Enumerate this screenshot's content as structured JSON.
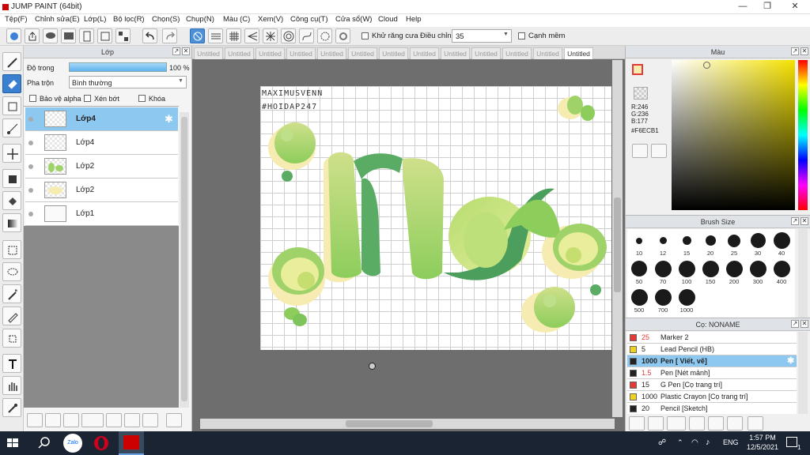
{
  "window": {
    "title": "JUMP PAINT (64bit)"
  },
  "menu": [
    "Tệp(F)",
    "Chỉnh sửa(E)",
    "Lớp(L)",
    "Bộ lọc(R)",
    "Chọn(S)",
    "Chụp(N)",
    "Màu (C)",
    "Xem(V)",
    "Công cụ(T)",
    "Cửa sổ(W)",
    "Cloud",
    "Help"
  ],
  "toolbar": {
    "antialias_label": "Khử răng cưa",
    "adjust_label": "Điều chỉnh",
    "adjust_value": "35",
    "smooth_label": "Cạnh mềm"
  },
  "layer_panel": {
    "title": "Lớp",
    "opacity_label": "Độ trong",
    "opacity_value": "100 %",
    "opacity_level": 1.0,
    "blend_label": "Pha trộn",
    "blend_value": "Bình thường",
    "protect_alpha": "Bảo vệ alpha",
    "clip": "Xén bớt",
    "lock": "Khóa",
    "layers": [
      {
        "name": "Lớp4",
        "selected": true
      },
      {
        "name": "Lớp4",
        "selected": false
      },
      {
        "name": "Lớp2",
        "selected": false
      },
      {
        "name": "Lớp2",
        "selected": false
      },
      {
        "name": "Lớp1",
        "selected": false
      }
    ]
  },
  "tabs": [
    "Untitled",
    "Untitled",
    "Untitled",
    "Untitled",
    "Untitled",
    "Untitled",
    "Untitled",
    "Untitled",
    "Untitled",
    "Untitled",
    "Untitled",
    "Untitled",
    "Untitled"
  ],
  "artwork": {
    "signature": "MAXIMUSVENN",
    "hashtag": "#HOIDAP247"
  },
  "color_panel": {
    "title": "Màu",
    "r": "R:246",
    "g": "G:236",
    "b": "B:177",
    "hex": "#F6ECB1",
    "current_color": "#F6ECB1"
  },
  "brush_size": {
    "title": "Brush Size",
    "sizes": [
      "10",
      "12",
      "15",
      "20",
      "25",
      "30",
      "40",
      "50",
      "70",
      "100",
      "150",
      "200",
      "300",
      "400",
      "500",
      "700",
      "1000"
    ]
  },
  "brushes": {
    "title": "Cọ: NONAME",
    "items": [
      {
        "size": "25",
        "name": "Marker 2",
        "color": "#e53935",
        "selected": false,
        "size_red": true
      },
      {
        "size": "5",
        "name": "Lead Pencil (HB)",
        "color": "#f0d020",
        "selected": false,
        "size_red": false
      },
      {
        "size": "1000",
        "name": "Pen [ Viết, vẽ]",
        "color": "#222222",
        "selected": true,
        "size_red": false
      },
      {
        "size": "1.5",
        "name": "Pen [Nét mảnh]",
        "color": "#222222",
        "selected": false,
        "size_red": true
      },
      {
        "size": "15",
        "name": "G Pen [Cọ trang trí]",
        "color": "#e53935",
        "selected": false,
        "size_red": false
      },
      {
        "size": "1000",
        "name": "Plastic Crayon [Cọ trang trí]",
        "color": "#f0d020",
        "selected": false,
        "size_red": false
      },
      {
        "size": "20",
        "name": "Pencil [Sketch]",
        "color": "#222222",
        "selected": false,
        "size_red": false
      }
    ]
  },
  "taskbar": {
    "lang": "ENG",
    "time": "1:57 PM",
    "date": "12/5/2021",
    "notif": "1",
    "zalo": "Zalo"
  }
}
